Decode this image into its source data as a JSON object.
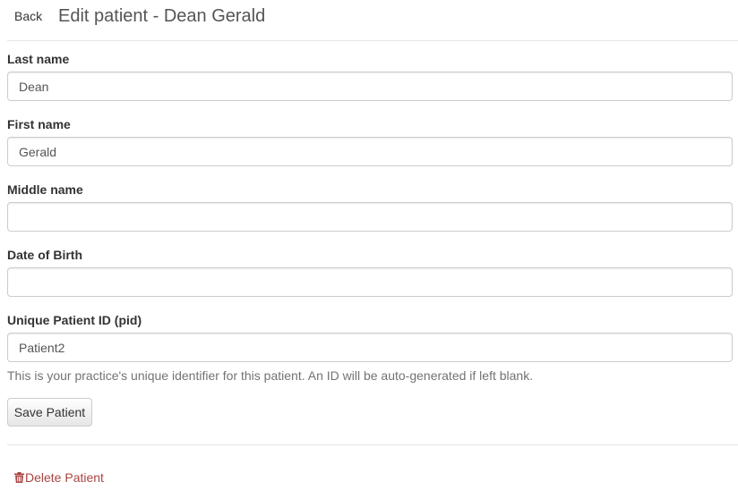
{
  "header": {
    "back_label": "Back",
    "title": "Edit patient - Dean Gerald"
  },
  "form": {
    "last_name": {
      "label": "Last name",
      "value": "Dean"
    },
    "first_name": {
      "label": "First name",
      "value": "Gerald"
    },
    "middle_name": {
      "label": "Middle name",
      "value": ""
    },
    "date_of_birth": {
      "label": "Date of Birth",
      "value": ""
    },
    "patient_id": {
      "label": "Unique Patient ID (pid)",
      "value": "Patient2",
      "help": "This is your practice's unique identifier for this patient. An ID will be auto-generated if left blank."
    },
    "save_label": "Save Patient"
  },
  "delete": {
    "label": "Delete Patient",
    "icon": "trash-icon",
    "color": "#a94442"
  }
}
